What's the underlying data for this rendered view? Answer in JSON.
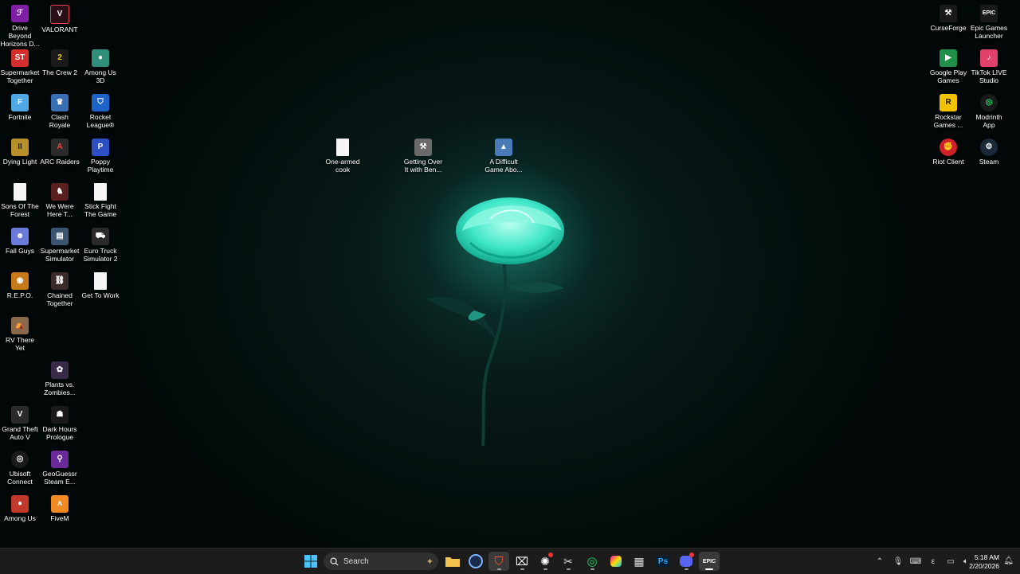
{
  "desktop": {
    "left_icons": [
      {
        "label": "Drive Beyond Horizons D...",
        "icon": "drive-beyond-horizons-icon",
        "color": "#7e1fa6"
      },
      {
        "label": "VALORANT",
        "icon": "valorant-icon",
        "color": "#2b0f16"
      },
      {
        "label": "Supermarket Together",
        "icon": "supermarket-together-icon",
        "color": "#d32f2f"
      },
      {
        "label": "The Crew 2",
        "icon": "the-crew-2-icon",
        "color": "#1a1a1a"
      },
      {
        "label": "Among Us 3D",
        "icon": "among-us-3d-icon",
        "color": "#2f8f7a"
      },
      {
        "label": "Fortnite",
        "icon": "fortnite-icon",
        "color": "#4fa8e6"
      },
      {
        "label": "Clash Royale",
        "icon": "clash-royale-icon",
        "color": "#3a6fb5"
      },
      {
        "label": "Rocket League®",
        "icon": "rocket-league-icon",
        "color": "#1e63c8"
      },
      {
        "label": "Dying Light",
        "icon": "dying-light-icon",
        "color": "#b8902a"
      },
      {
        "label": "ARC Raiders",
        "icon": "arc-raiders-icon",
        "color": "#2a2a2a"
      },
      {
        "label": "Poppy Playtime",
        "icon": "poppy-playtime-icon",
        "color": "#2d4fc4"
      },
      {
        "label": "Sons Of The Forest",
        "icon": "sons-of-the-forest-icon",
        "color": "#f0f0f0"
      },
      {
        "label": "We Were Here T...",
        "icon": "we-were-here-icon",
        "color": "#5a1f1f"
      },
      {
        "label": "Stick Fight The Game",
        "icon": "stick-fight-icon",
        "color": "#f0f0f0"
      },
      {
        "label": "Fall Guys",
        "icon": "fall-guys-icon",
        "color": "#6a7ad8"
      },
      {
        "label": "Supermarket Simulator",
        "icon": "supermarket-simulator-icon",
        "color": "#3b5470"
      },
      {
        "label": "Euro Truck Simulator 2",
        "icon": "euro-truck-simulator-icon",
        "color": "#2a2a2a"
      },
      {
        "label": "R.E.P.O.",
        "icon": "repo-icon",
        "color": "#c47a18"
      },
      {
        "label": "Chained Together",
        "icon": "chained-together-icon",
        "color": "#3a2a2a"
      },
      {
        "label": "Get To Work",
        "icon": "get-to-work-icon",
        "color": "#f0f0f0"
      },
      {
        "label": "RV There Yet",
        "icon": "rv-there-yet-icon",
        "color": "#8a6a4a"
      },
      {
        "label": "Plants vs. Zombies...",
        "icon": "plants-vs-zombies-icon",
        "color": "#3a2a4a"
      },
      {
        "label": "Grand Theft Auto V",
        "icon": "gta-v-icon",
        "color": "#2a2a2a"
      },
      {
        "label": "Dark Hours Prologue",
        "icon": "dark-hours-icon",
        "color": "#1a1a1a"
      },
      {
        "label": "Ubisoft Connect",
        "icon": "ubisoft-connect-icon",
        "color": "#1a1a1a"
      },
      {
        "label": "GeoGuessr Steam E...",
        "icon": "geoguessr-icon",
        "color": "#6a2a9a"
      },
      {
        "label": "Among Us",
        "icon": "among-us-icon",
        "color": "#c0392b"
      },
      {
        "label": "FiveM",
        "icon": "fivem-icon",
        "color": "#f08a24"
      }
    ],
    "center_icons": [
      {
        "label": "One-armed cook",
        "icon": "one-armed-cook-icon",
        "color": "#f0f0f0"
      },
      {
        "label": "Getting Over It with Ben...",
        "icon": "getting-over-it-icon",
        "color": "#6a6a6a"
      },
      {
        "label": "A Difficult Game Abo...",
        "icon": "a-difficult-game-icon",
        "color": "#4a7ab8"
      }
    ],
    "right_icons": [
      {
        "label": "CurseForge",
        "icon": "curseforge-icon",
        "color": "#1a1a1a"
      },
      {
        "label": "Epic Games Launcher",
        "icon": "epic-games-launcher-icon",
        "color": "#1a1a1a"
      },
      {
        "label": "Google Play Games",
        "icon": "google-play-games-icon",
        "color": "#1f8f4a"
      },
      {
        "label": "TikTok LIVE Studio",
        "icon": "tiktok-live-studio-icon",
        "color": "#e0406a"
      },
      {
        "label": "Rockstar Games ...",
        "icon": "rockstar-games-icon",
        "color": "#f2c200"
      },
      {
        "label": "Modrinth App",
        "icon": "modrinth-app-icon",
        "color": "#1a1a1a"
      },
      {
        "label": "Riot Client",
        "icon": "riot-client-icon",
        "color": "#d0202a"
      },
      {
        "label": "Steam",
        "icon": "steam-icon",
        "color": "#1b2838"
      }
    ]
  },
  "taskbar": {
    "search_placeholder": "Search",
    "clock_time": "5:18 AM",
    "clock_date": "2/20/2026",
    "tray_lang": "ε"
  }
}
